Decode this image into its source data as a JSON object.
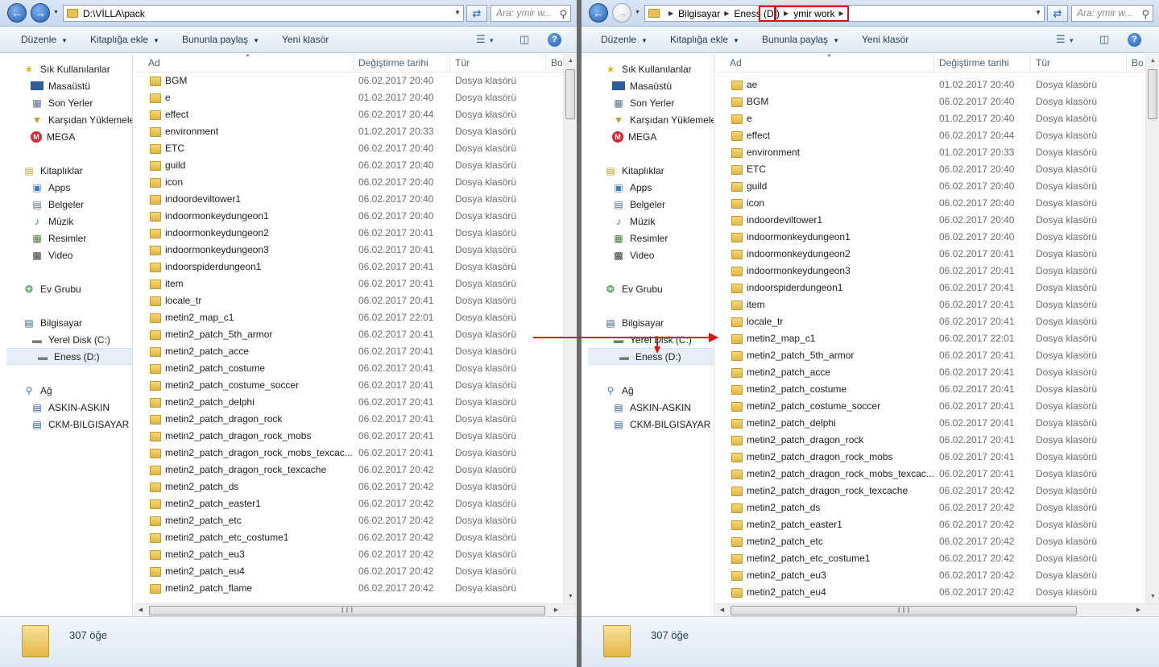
{
  "colors": {
    "accent": "#1f5fb3",
    "annotation_red": "#e01010",
    "folder": "#e8c04f"
  },
  "left": {
    "address_path": "D:\\VİLLA\\pack",
    "search_placeholder": "Ara: ymir w...",
    "toolbar": {
      "organize": "Düzenle",
      "include": "Kitaplığa ekle",
      "share": "Bununla paylaş",
      "new_folder": "Yeni klasör"
    },
    "columns": {
      "name": "Ad",
      "date": "Değiştirme tarihi",
      "type": "Tür",
      "size": "Bo"
    },
    "status": "307 öğe",
    "items": [
      {
        "name": "BGM",
        "date": "06.02.2017 20:40",
        "type": "Dosya klasörü"
      },
      {
        "name": "e",
        "date": "01.02.2017 20:40",
        "type": "Dosya klasörü"
      },
      {
        "name": "effect",
        "date": "06.02.2017 20:44",
        "type": "Dosya klasörü"
      },
      {
        "name": "environment",
        "date": "01.02.2017 20:33",
        "type": "Dosya klasörü"
      },
      {
        "name": "ETC",
        "date": "06.02.2017 20:40",
        "type": "Dosya klasörü"
      },
      {
        "name": "guild",
        "date": "06.02.2017 20:40",
        "type": "Dosya klasörü"
      },
      {
        "name": "icon",
        "date": "06.02.2017 20:40",
        "type": "Dosya klasörü"
      },
      {
        "name": "indoordeviltower1",
        "date": "06.02.2017 20:40",
        "type": "Dosya klasörü"
      },
      {
        "name": "indoormonkeydungeon1",
        "date": "06.02.2017 20:40",
        "type": "Dosya klasörü"
      },
      {
        "name": "indoormonkeydungeon2",
        "date": "06.02.2017 20:41",
        "type": "Dosya klasörü"
      },
      {
        "name": "indoormonkeydungeon3",
        "date": "06.02.2017 20:41",
        "type": "Dosya klasörü"
      },
      {
        "name": "indoorspiderdungeon1",
        "date": "06.02.2017 20:41",
        "type": "Dosya klasörü"
      },
      {
        "name": "item",
        "date": "06.02.2017 20:41",
        "type": "Dosya klasörü"
      },
      {
        "name": "locale_tr",
        "date": "06.02.2017 20:41",
        "type": "Dosya klasörü"
      },
      {
        "name": "metin2_map_c1",
        "date": "06.02.2017 22:01",
        "type": "Dosya klasörü"
      },
      {
        "name": "metin2_patch_5th_armor",
        "date": "06.02.2017 20:41",
        "type": "Dosya klasörü"
      },
      {
        "name": "metin2_patch_acce",
        "date": "06.02.2017 20:41",
        "type": "Dosya klasörü"
      },
      {
        "name": "metin2_patch_costume",
        "date": "06.02.2017 20:41",
        "type": "Dosya klasörü"
      },
      {
        "name": "metin2_patch_costume_soccer",
        "date": "06.02.2017 20:41",
        "type": "Dosya klasörü"
      },
      {
        "name": "metin2_patch_delphi",
        "date": "06.02.2017 20:41",
        "type": "Dosya klasörü"
      },
      {
        "name": "metin2_patch_dragon_rock",
        "date": "06.02.2017 20:41",
        "type": "Dosya klasörü"
      },
      {
        "name": "metin2_patch_dragon_rock_mobs",
        "date": "06.02.2017 20:41",
        "type": "Dosya klasörü"
      },
      {
        "name": "metin2_patch_dragon_rock_mobs_texcac...",
        "date": "06.02.2017 20:41",
        "type": "Dosya klasörü"
      },
      {
        "name": "metin2_patch_dragon_rock_texcache",
        "date": "06.02.2017 20:42",
        "type": "Dosya klasörü"
      },
      {
        "name": "metin2_patch_ds",
        "date": "06.02.2017 20:42",
        "type": "Dosya klasörü"
      },
      {
        "name": "metin2_patch_easter1",
        "date": "06.02.2017 20:42",
        "type": "Dosya klasörü"
      },
      {
        "name": "metin2_patch_etc",
        "date": "06.02.2017 20:42",
        "type": "Dosya klasörü"
      },
      {
        "name": "metin2_patch_etc_costume1",
        "date": "06.02.2017 20:42",
        "type": "Dosya klasörü"
      },
      {
        "name": "metin2_patch_eu3",
        "date": "06.02.2017 20:42",
        "type": "Dosya klasörü"
      },
      {
        "name": "metin2_patch_eu4",
        "date": "06.02.2017 20:42",
        "type": "Dosya klasörü"
      },
      {
        "name": "metin2_patch_flame",
        "date": "06.02.2017 20:42",
        "type": "Dosya klasörü"
      }
    ]
  },
  "right": {
    "breadcrumb": [
      "Bilgisayar",
      "Eness (D:)",
      "ymir work"
    ],
    "search_placeholder": "Ara: ymir w...",
    "toolbar": {
      "organize": "Düzenle",
      "include": "Kitaplığa ekle",
      "share": "Bununla paylaş",
      "new_folder": "Yeni klasör"
    },
    "columns": {
      "name": "Ad",
      "date": "Değiştirme tarihi",
      "type": "Tür",
      "size": "Bo"
    },
    "status": "307 öğe",
    "items": [
      {
        "name": "ae",
        "date": "01.02.2017 20:40",
        "type": "Dosya klasörü"
      },
      {
        "name": "BGM",
        "date": "06.02.2017 20:40",
        "type": "Dosya klasörü"
      },
      {
        "name": "e",
        "date": "01.02.2017 20:40",
        "type": "Dosya klasörü"
      },
      {
        "name": "effect",
        "date": "06.02.2017 20:44",
        "type": "Dosya klasörü"
      },
      {
        "name": "environment",
        "date": "01.02.2017 20:33",
        "type": "Dosya klasörü"
      },
      {
        "name": "ETC",
        "date": "06.02.2017 20:40",
        "type": "Dosya klasörü"
      },
      {
        "name": "guild",
        "date": "06.02.2017 20:40",
        "type": "Dosya klasörü"
      },
      {
        "name": "icon",
        "date": "06.02.2017 20:40",
        "type": "Dosya klasörü"
      },
      {
        "name": "indoordeviltower1",
        "date": "06.02.2017 20:40",
        "type": "Dosya klasörü"
      },
      {
        "name": "indoormonkeydungeon1",
        "date": "06.02.2017 20:40",
        "type": "Dosya klasörü"
      },
      {
        "name": "indoormonkeydungeon2",
        "date": "06.02.2017 20:41",
        "type": "Dosya klasörü"
      },
      {
        "name": "indoormonkeydungeon3",
        "date": "06.02.2017 20:41",
        "type": "Dosya klasörü"
      },
      {
        "name": "indoorspiderdungeon1",
        "date": "06.02.2017 20:41",
        "type": "Dosya klasörü"
      },
      {
        "name": "item",
        "date": "06.02.2017 20:41",
        "type": "Dosya klasörü"
      },
      {
        "name": "locale_tr",
        "date": "06.02.2017 20:41",
        "type": "Dosya klasörü"
      },
      {
        "name": "metin2_map_c1",
        "date": "06.02.2017 22:01",
        "type": "Dosya klasörü"
      },
      {
        "name": "metin2_patch_5th_armor",
        "date": "06.02.2017 20:41",
        "type": "Dosya klasörü"
      },
      {
        "name": "metin2_patch_acce",
        "date": "06.02.2017 20:41",
        "type": "Dosya klasörü"
      },
      {
        "name": "metin2_patch_costume",
        "date": "06.02.2017 20:41",
        "type": "Dosya klasörü"
      },
      {
        "name": "metin2_patch_costume_soccer",
        "date": "06.02.2017 20:41",
        "type": "Dosya klasörü"
      },
      {
        "name": "metin2_patch_delphi",
        "date": "06.02.2017 20:41",
        "type": "Dosya klasörü"
      },
      {
        "name": "metin2_patch_dragon_rock",
        "date": "06.02.2017 20:41",
        "type": "Dosya klasörü"
      },
      {
        "name": "metin2_patch_dragon_rock_mobs",
        "date": "06.02.2017 20:41",
        "type": "Dosya klasörü"
      },
      {
        "name": "metin2_patch_dragon_rock_mobs_texcac...",
        "date": "06.02.2017 20:41",
        "type": "Dosya klasörü"
      },
      {
        "name": "metin2_patch_dragon_rock_texcache",
        "date": "06.02.2017 20:42",
        "type": "Dosya klasörü"
      },
      {
        "name": "metin2_patch_ds",
        "date": "06.02.2017 20:42",
        "type": "Dosya klasörü"
      },
      {
        "name": "metin2_patch_easter1",
        "date": "06.02.2017 20:42",
        "type": "Dosya klasörü"
      },
      {
        "name": "metin2_patch_etc",
        "date": "06.02.2017 20:42",
        "type": "Dosya klasörü"
      },
      {
        "name": "metin2_patch_etc_costume1",
        "date": "06.02.2017 20:42",
        "type": "Dosya klasörü"
      },
      {
        "name": "metin2_patch_eu3",
        "date": "06.02.2017 20:42",
        "type": "Dosya klasörü"
      },
      {
        "name": "metin2_patch_eu4",
        "date": "06.02.2017 20:42",
        "type": "Dosya klasörü"
      }
    ]
  },
  "navpane": {
    "favorites": "Sık Kullanılanlar",
    "fav_items": [
      {
        "label": "Masaüstü",
        "icon": "desktop-icon"
      },
      {
        "label": "Son Yerler",
        "icon": "recent-places-icon"
      },
      {
        "label": "Karşıdan Yüklemeler",
        "icon": "downloads-icon"
      },
      {
        "label": "MEGA",
        "icon": "mega-icon"
      }
    ],
    "libraries": "Kitaplıklar",
    "lib_items": [
      {
        "label": "Apps",
        "icon": "apps-library-icon"
      },
      {
        "label": "Belgeler",
        "icon": "documents-icon"
      },
      {
        "label": "Müzik",
        "icon": "music-icon"
      },
      {
        "label": "Resimler",
        "icon": "pictures-icon"
      },
      {
        "label": "Video",
        "icon": "video-icon"
      }
    ],
    "homegroup": "Ev Grubu",
    "computer": "Bilgisayar",
    "drives": [
      {
        "label": "Yerel Disk (C:)",
        "icon": "local-disk-icon"
      },
      {
        "label": "Eness (D:)",
        "icon": "drive-icon"
      }
    ],
    "network": "Ağ",
    "net_items": [
      {
        "label": "ASKIN-ASKIN",
        "icon": "network-computer-icon"
      },
      {
        "label": "CKM-BILGISAYAR",
        "icon": "network-computer-icon"
      }
    ]
  }
}
